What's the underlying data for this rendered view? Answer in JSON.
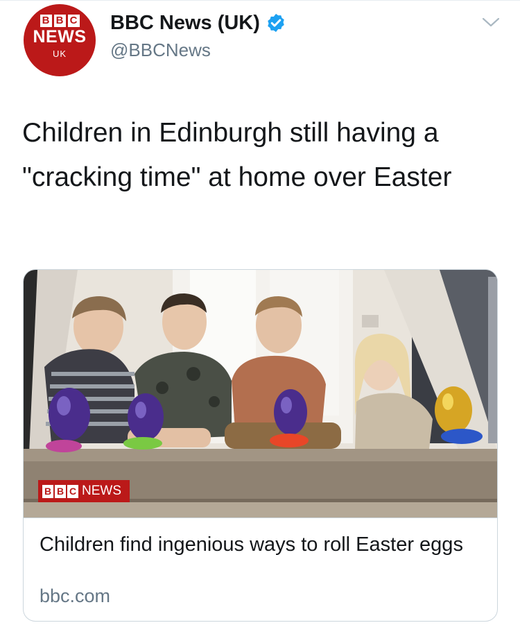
{
  "tweet": {
    "avatar": {
      "letters": [
        "B",
        "B",
        "C"
      ],
      "news": "NEWS",
      "region": "UK"
    },
    "display_name": "BBC News (UK)",
    "handle": "@BBCNews",
    "verified": true,
    "text": "Children in Edinburgh still having a \"cracking time\" at home over Easter"
  },
  "card": {
    "title": "Children find ingenious ways to roll Easter eggs",
    "domain": "bbc.com",
    "watermark": {
      "letters": [
        "B",
        "B",
        "C"
      ],
      "news": "NEWS"
    }
  },
  "icons": {
    "verified": "verified-badge-icon",
    "menu": "chevron-down-icon"
  },
  "colors": {
    "bbc_red": "#bb1919",
    "verified_blue": "#1da1f2",
    "secondary_text": "#657786"
  }
}
